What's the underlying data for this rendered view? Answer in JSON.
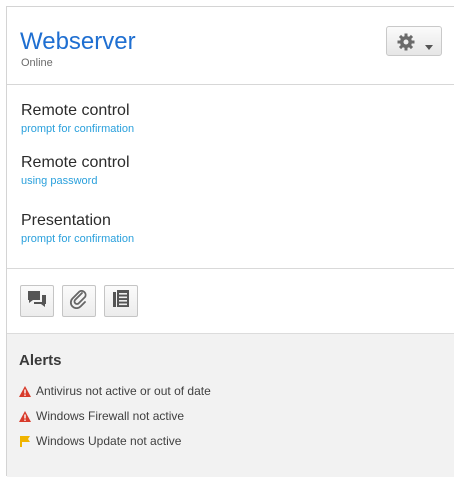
{
  "device": {
    "title": "Webserver",
    "status": "Online"
  },
  "menu_icon": "gear-icon",
  "connections": [
    {
      "title": "Remote control",
      "subtitle": "prompt for confirmation"
    },
    {
      "title": "Remote control",
      "subtitle": "using password"
    },
    {
      "title": "Presentation",
      "subtitle": "prompt for confirmation"
    }
  ],
  "toolbar": {
    "buttons": [
      {
        "icon": "chat-icon"
      },
      {
        "icon": "paperclip-icon"
      },
      {
        "icon": "document-list-icon"
      }
    ]
  },
  "alerts": {
    "title": "Alerts",
    "items": [
      {
        "text": "Antivirus not active or out of date",
        "icon": "warning-triangle-icon",
        "color": "#d83b2b"
      },
      {
        "text": "Windows Firewall not active",
        "icon": "warning-triangle-icon",
        "color": "#d83b2b"
      },
      {
        "text": "Windows Update not active",
        "icon": "flag-icon",
        "color": "#f0b400"
      }
    ]
  },
  "colors": {
    "title": "#1f6fd1",
    "link": "#2aa0dc",
    "alerts_bg": "#f2f2f2"
  }
}
